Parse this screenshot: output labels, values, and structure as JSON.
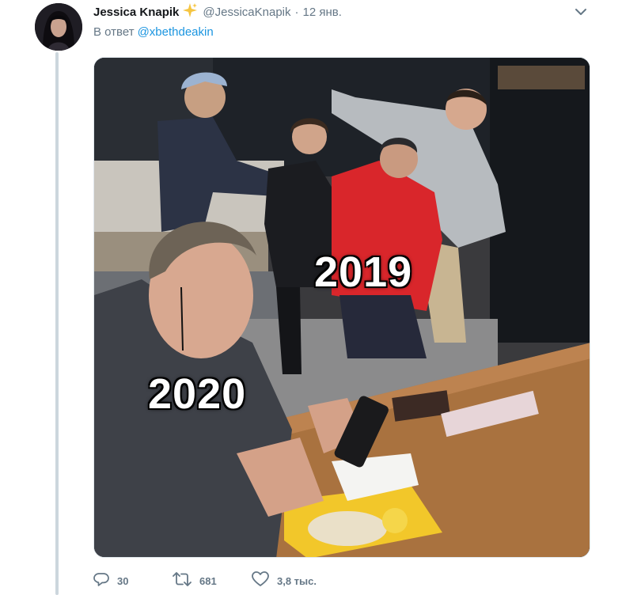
{
  "tweet": {
    "author": {
      "display_name": "Jessica Knapik",
      "emoji": "✨",
      "handle": "@JessicaKnapik"
    },
    "separator": "·",
    "timestamp": "12 янв.",
    "reply_prefix": "В ответ",
    "reply_mention": "@xbethdeakin",
    "media": {
      "caption_top": "2019",
      "caption_bottom": "2020"
    },
    "actions": {
      "reply_count": "30",
      "retweet_count": "681",
      "like_count": "3,8 тыс."
    }
  },
  "colors": {
    "text_primary": "#14171a",
    "text_secondary": "#657786",
    "link": "#1b95e0",
    "thread_line": "#ccd6dd"
  },
  "icons": {
    "avatar": "user-avatar",
    "sparkle": "sparkles-icon",
    "caret": "chevron-down-icon",
    "reply": "reply-icon",
    "retweet": "retweet-icon",
    "like": "heart-icon"
  }
}
